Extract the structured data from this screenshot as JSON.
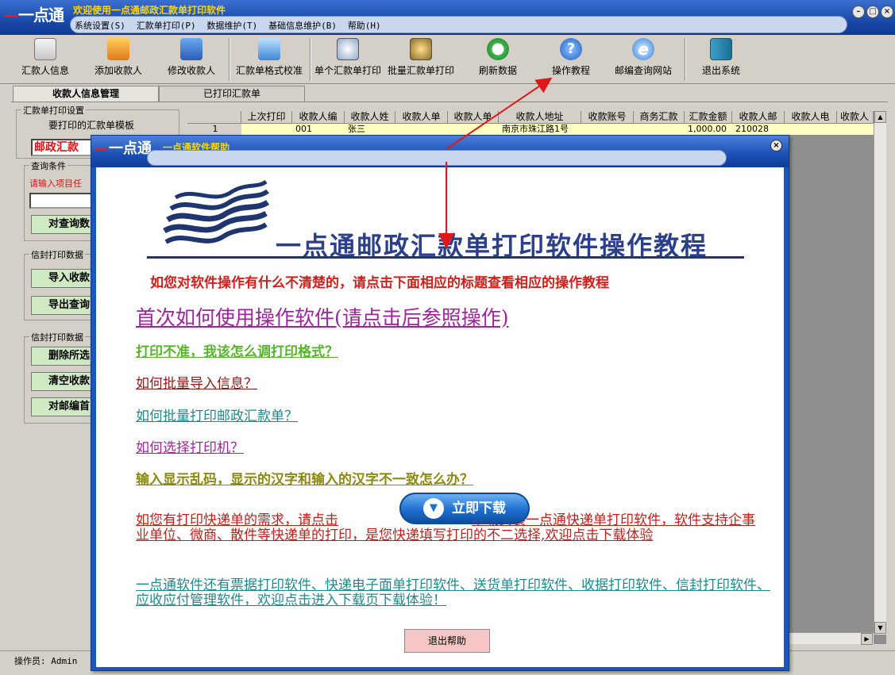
{
  "window": {
    "logo": "一点通",
    "title": "欢迎使用一点通邮政汇款单打印软件",
    "menu": [
      "系统设置(S)",
      "汇款单打印(P)",
      "数据维护(T)",
      "基础信息维护(B)",
      "帮助(H)"
    ]
  },
  "toolbar": [
    {
      "label": "汇款人信息",
      "icon": "user-card-icon"
    },
    {
      "label": "添加收款人",
      "icon": "add-people-icon"
    },
    {
      "label": "修改收款人",
      "icon": "edit-person-icon"
    },
    {
      "label": "汇款单格式校准",
      "icon": "calibrate-icon"
    },
    {
      "label": "单个汇款单打印",
      "icon": "single-print-icon"
    },
    {
      "label": "批量汇款单打印",
      "icon": "batch-print-icon"
    },
    {
      "label": "刷新数据",
      "icon": "refresh-icon"
    },
    {
      "label": "操作教程",
      "icon": "help-icon"
    },
    {
      "label": "邮编查询网站",
      "icon": "ie-icon"
    },
    {
      "label": "退出系统",
      "icon": "exit-icon"
    }
  ],
  "tabs": [
    "收款人信息管理",
    "已打印汇款单"
  ],
  "left": {
    "group1_label": "汇款单打印设置",
    "template_label": "要打印的汇款单模板",
    "template_value": "邮政汇款",
    "query_group": "查询条件",
    "query_hint": "请输入项目任",
    "query_button": "对查询数",
    "group2_label": "信封打印数据",
    "import_button": "导入收款",
    "export_button": "导出查询",
    "group3_label": "信封打印数据",
    "delete_button": "删除所选",
    "clear_button": "清空收款",
    "postcode_button": "对邮编首"
  },
  "grid": {
    "headers": [
      "上次打印",
      "收款人编",
      "收款人姓",
      "收款人单",
      "收款人单",
      "收款人地址",
      "收款账号",
      "商务汇款",
      "汇款金额",
      "收款人邮",
      "收款人电",
      "收款人"
    ],
    "row": {
      "num": "1",
      "code": "001",
      "name": "张三",
      "address": "南京市珠江路1号",
      "amount": "1,000.00",
      "postcode": "210028"
    }
  },
  "status": {
    "operator": "操作员: Admin"
  },
  "dialog": {
    "logo": "一点通",
    "title": "一点通软件帮助",
    "heading": "一点通邮政汇款单打印软件操作教程",
    "intro": "如您对软件操作有什么不清楚的，请点击下面相应的标题查看相应的操作教程",
    "links": [
      "首次如何使用操作软件(请点击后参照操作)",
      "打印不准，我该怎么调打印格式？",
      "如何批量导入信息？",
      "如何批量打印邮政汇款单？",
      "如何选择打印机？",
      "输入显示乱码，显示的汉字和输入的汉字不一致怎么办？"
    ],
    "express_prefix": "如您有打印快递单的需求，请点击",
    "express_suffix": "下载安装一点通快递单打印软件，软件支持企事业单位、微商、散件等快递单的打印，是您快递填写打印的不二选择,欢迎点击下载体验",
    "download_button": "立即下载",
    "more_software": "一点通软件还有票据打印软件、快递电子面单打印软件、送货单打印软件、收据打印软件、信封打印软件、应收应付管理软件，欢迎点击进入下载页下载体验！",
    "exit_button": "退出帮助"
  },
  "colors": {
    "accent": "#1a4aa8",
    "link_purple": "#a0249c",
    "link_green": "#56b52a",
    "link_darkred": "#8b1a1a",
    "link_teal": "#1f8a8a",
    "link_olive": "#8a8a10",
    "link_red": "#c0201c"
  }
}
